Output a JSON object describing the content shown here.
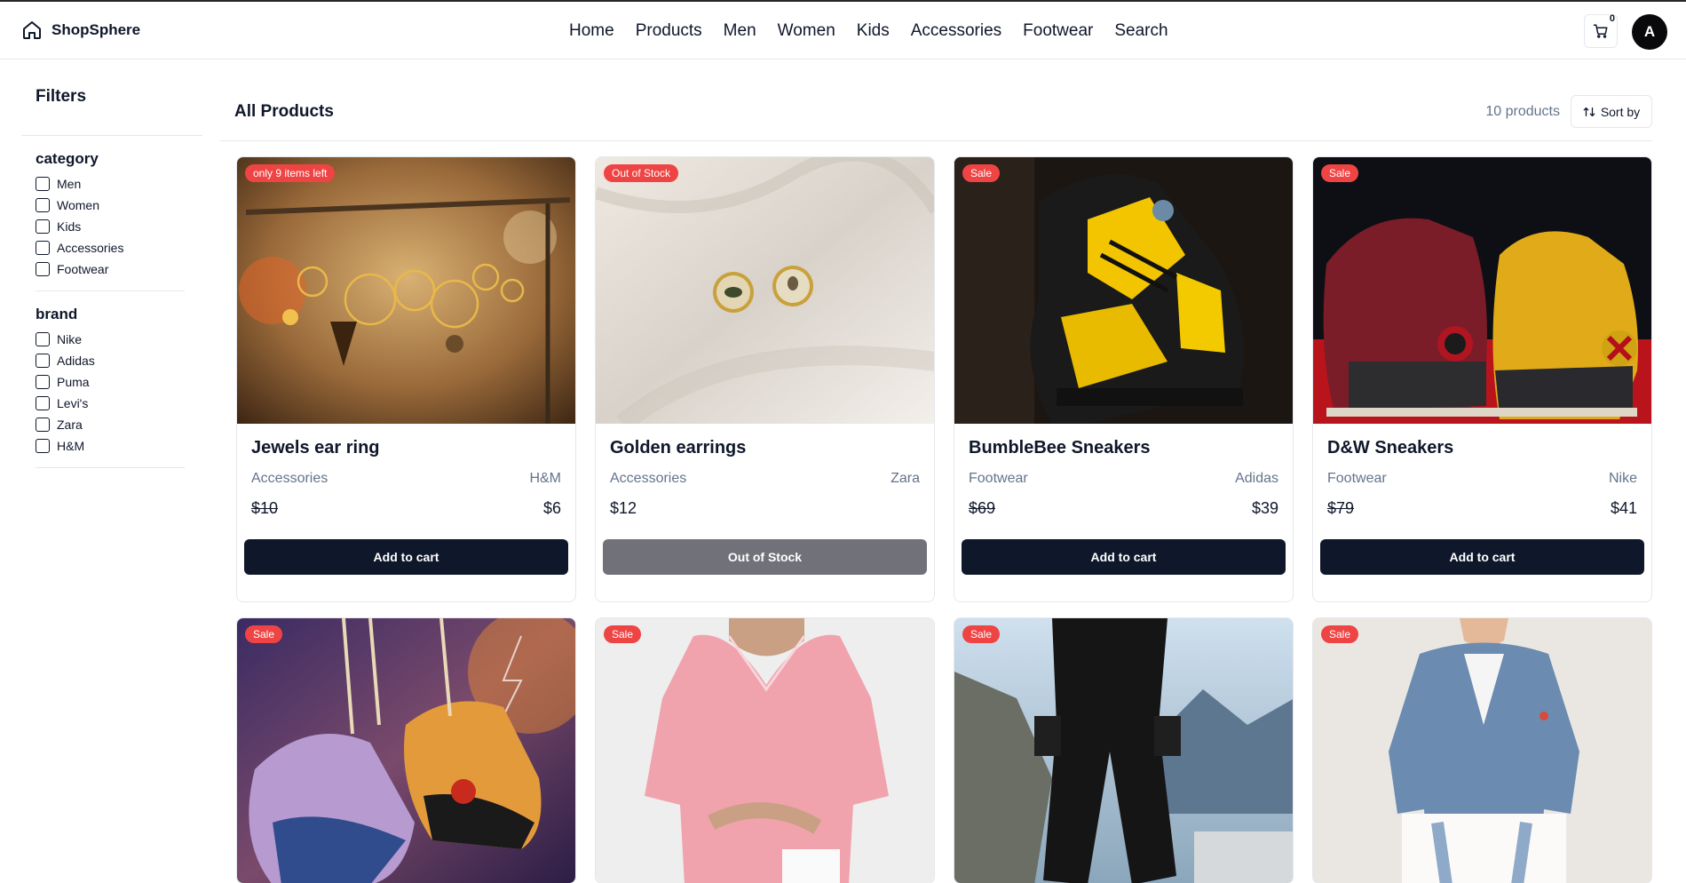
{
  "header": {
    "brand": "ShopSphere",
    "nav": [
      "Home",
      "Products",
      "Men",
      "Women",
      "Kids",
      "Accessories",
      "Footwear",
      "Search"
    ],
    "cart_count": "0",
    "avatar_initial": "A"
  },
  "sidebar": {
    "title": "Filters",
    "groups": [
      {
        "title": "category",
        "options": [
          "Men",
          "Women",
          "Kids",
          "Accessories",
          "Footwear"
        ]
      },
      {
        "title": "brand",
        "options": [
          "Nike",
          "Adidas",
          "Puma",
          "Levi's",
          "Zara",
          "H&M"
        ]
      }
    ]
  },
  "main": {
    "title": "All Products",
    "count": "10 products",
    "sort_label": "Sort by"
  },
  "products": [
    {
      "badge": "only 9 items left",
      "name": "Jewels ear ring",
      "category": "Accessories",
      "brand": "H&M",
      "old_price": "$10",
      "price": "$6",
      "action": "Add to cart"
    },
    {
      "badge": "Out of Stock",
      "name": "Golden earrings",
      "category": "Accessories",
      "brand": "Zara",
      "old_price": "",
      "price": "$12",
      "action": "Out of Stock"
    },
    {
      "badge": "Sale",
      "name": "BumbleBee Sneakers",
      "category": "Footwear",
      "brand": "Adidas",
      "old_price": "$69",
      "price": "$39",
      "action": "Add to cart"
    },
    {
      "badge": "Sale",
      "name": "D&W Sneakers",
      "category": "Footwear",
      "brand": "Nike",
      "old_price": "$79",
      "price": "$41",
      "action": "Add to cart"
    },
    {
      "badge": "Sale"
    },
    {
      "badge": "Sale"
    },
    {
      "badge": "Sale"
    },
    {
      "badge": "Sale"
    }
  ]
}
